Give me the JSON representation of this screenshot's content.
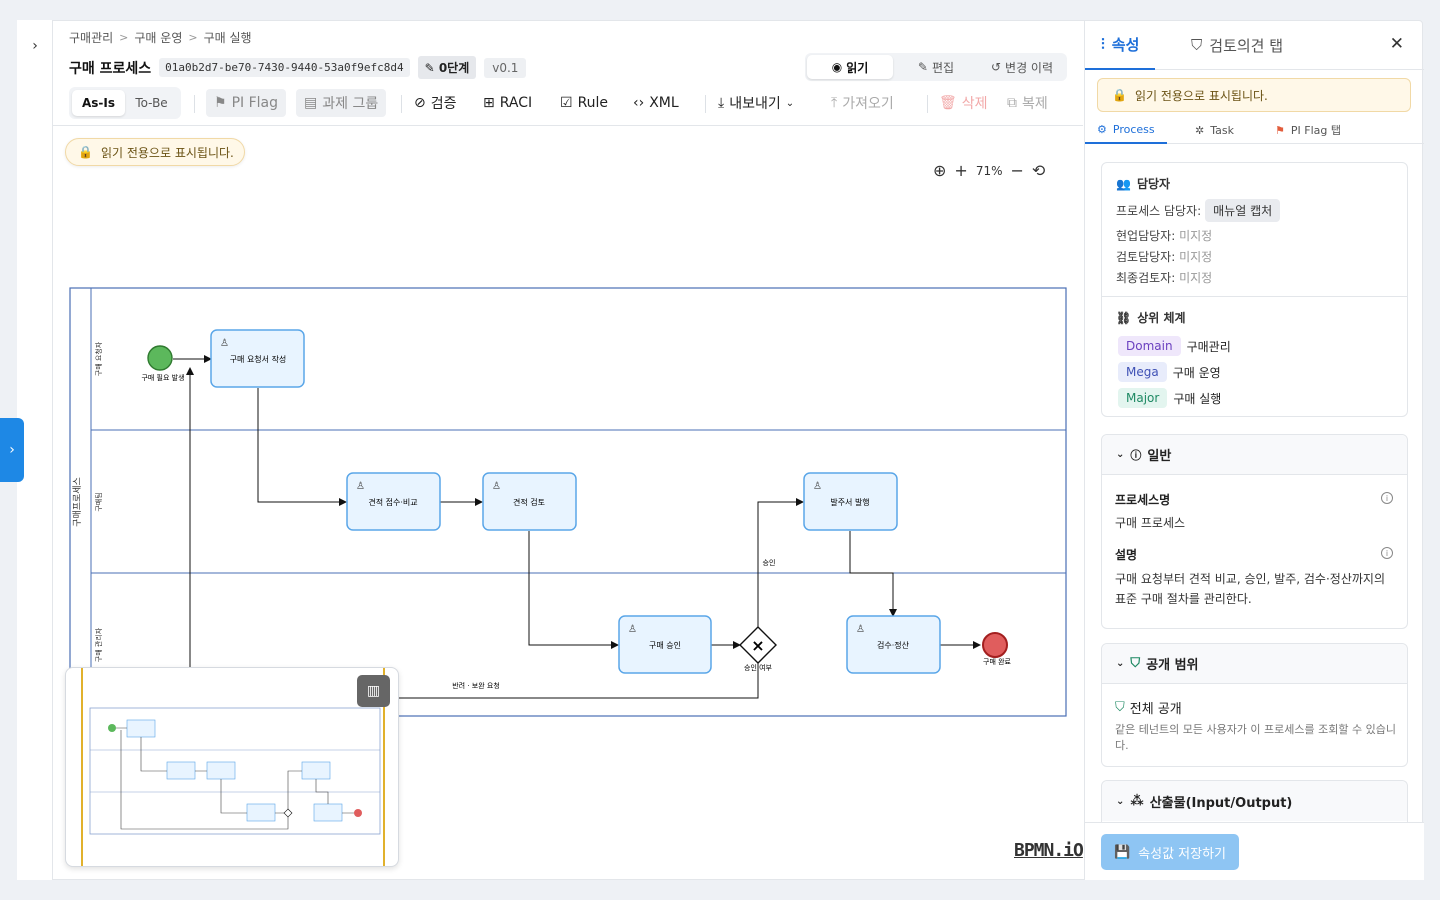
{
  "breadcrumb": [
    "구매관리",
    "구매 운영",
    "구매 실행"
  ],
  "breadcrumb_sep": ">",
  "header": {
    "title": "구매 프로세스",
    "uuid": "01a0b2d7-be70-7430-9440-53a0f9efc8d4",
    "stage": "0단계",
    "version": "v0.1"
  },
  "modes": {
    "read": "읽기",
    "edit": "편집",
    "history": "변경 이력"
  },
  "toolbar": {
    "asis": "As-Is",
    "tobe": "To-Be",
    "piflag": "PI Flag",
    "task_group": "과제 그룹",
    "validate": "검증",
    "raci": "RACI",
    "rule": "Rule",
    "xml": "XML",
    "export": "내보내기",
    "import": "가져오기",
    "delete": "삭제",
    "copy": "복제"
  },
  "readonly_msg": "읽기 전용으로 표시됩니다.",
  "zoom": {
    "level": "71%"
  },
  "diagram": {
    "pool": "구매프로세스",
    "lanes": [
      "구매 요청자",
      "구매팀",
      "구매 관리자"
    ],
    "events": {
      "start": "구매 필요 발생",
      "end": "구매 완료"
    },
    "tasks": {
      "t1": "구매 요청서 작성",
      "t2": "견적 접수·비교",
      "t3": "견적 검토",
      "t4": "구매 승인",
      "t5": "발주서 발행",
      "t6": "검수·정산"
    },
    "gateway": "승인 여부",
    "flow_labels": {
      "approve": "승인",
      "reject": "반려 · 보완 요청"
    }
  },
  "watermark": "BPMN.iO",
  "panel": {
    "tabs": {
      "props": "속성",
      "review": "검토의견 탭"
    },
    "subtabs": {
      "process": "Process",
      "task": "Task",
      "piflag": "PI Flag 탭"
    },
    "owner": {
      "heading": "담당자",
      "process_owner_label": "프로세스 담당자:",
      "process_owner_value": "매뉴얼 캡처",
      "field_owner_label": "현업담당자:",
      "reviewer_label": "검토담당자:",
      "final_label": "최종검토자:",
      "unset": "미지정"
    },
    "hierarchy": {
      "heading": "상위 체계",
      "rows": [
        {
          "tag": "Domain",
          "value": "구매관리",
          "bg": "#efe7fb",
          "fg": "#6a3fbf"
        },
        {
          "tag": "Mega",
          "value": "구매 운영",
          "bg": "#e8ecfb",
          "fg": "#3f51b5"
        },
        {
          "tag": "Major",
          "value": "구매 실행",
          "bg": "#e3f5ef",
          "fg": "#1f8a64"
        }
      ]
    },
    "general": {
      "heading": "일반",
      "name_label": "프로세스명",
      "name_value": "구매 프로세스",
      "desc_label": "설명",
      "desc_value": "구매 요청부터 견적 비교, 승인, 발주, 검수·정산까지의 표준 구매 절차를 관리한다."
    },
    "scope": {
      "heading": "공개 범위",
      "value": "전체 공개",
      "desc": "같은 테넌트의 모든 사용자가 이 프로세스를 조회할 수 있습니다."
    },
    "io": {
      "heading": "산출물(Input/Output)"
    },
    "save": "속성값 저장하기"
  },
  "colors": {
    "accent": "#1e6fd9",
    "start": "#5cb85c",
    "end": "#e05d5d",
    "task_fill": "#e8f4ff",
    "task_stroke": "#5aa6e8"
  }
}
